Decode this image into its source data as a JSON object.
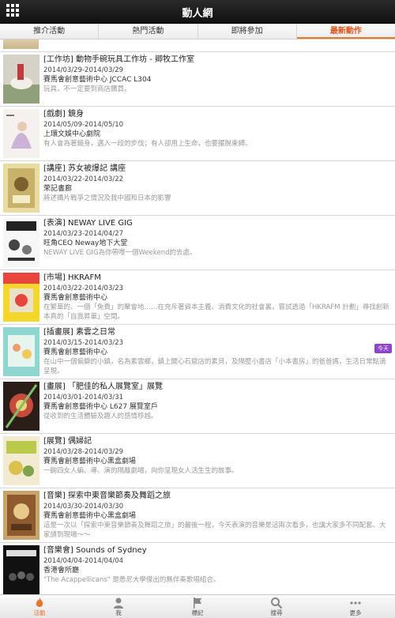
{
  "header": {
    "title": "動人網"
  },
  "tabs": [
    {
      "label": "推介活動"
    },
    {
      "label": "熱門活動"
    },
    {
      "label": "即將參加"
    },
    {
      "label": "最新動作"
    }
  ],
  "events": [
    {
      "title": "[工作坊] 動物手碗玩具工作坊 - 卿牧工作室",
      "date": "2014/03/29-2014/03/29",
      "venue": "賽馬會創意藝術中心 JCCAC L304",
      "desc": "玩具，不一定要到商店購買。",
      "badge": ""
    },
    {
      "title": "[戲劇] 鏡身",
      "date": "2014/05/09-2014/05/10",
      "venue": "上環文娛中心劇院",
      "desc": "有人會為著鏡身，邁入一段的步伐；有人卻用上生命，也要擺脫束縛。",
      "badge": ""
    },
    {
      "title": "[講座] 苏女被爆記 講座",
      "date": "2014/03/22-2014/03/22",
      "venue": "荣記書廊",
      "desc": "將述攝片戰爭之情況及我中國和日本的影響",
      "badge": ""
    },
    {
      "title": "[表演] NEWAY LIVE GIG",
      "date": "2014/03/23-2014/04/27",
      "venue": "旺角CEO Neway地下大堂",
      "desc": "NEWAY LIVE GIG為你帶嚟一個Weekend的去處。",
      "badge": ""
    },
    {
      "title": "[市場] HKRAFM",
      "date": "2014/03/22-2014/03/23",
      "venue": "賽馬會創意藝術中心",
      "desc": "在繁華的、一個「免費」的聚會地……在充斥著資本主義、消費文化的社會裏，嘗試透過「HKRAFM 計劃」尋找創新本真的「自我昇華」空間。",
      "badge": ""
    },
    {
      "title": "[插畫展] 素雲之日常",
      "date": "2014/03/15-2014/03/23",
      "venue": "賽馬會創意藝術中心",
      "desc": "在山中一個偏僻的小鎮，名為素雲鄉，鎮上開心石窟店的素貝，及隔壁小書店「小本書房」的爸爸媽，生活日常點滴呈現。",
      "badge": "今天"
    },
    {
      "title": "[畫展] 「肥佳的私人展覽室」展覽",
      "date": "2014/03/01-2014/03/31",
      "venue": "賽馬會創意藝術中心 L627 展覽室戶",
      "desc": "從收到的生活體驗及趣人的感情移越。",
      "badge": ""
    },
    {
      "title": "[展覽] 偶婦記",
      "date": "2014/03/28-2014/03/29",
      "venue": "賽馬會創意藝術中心黑盒劇場",
      "desc": "一齣四女人編、導、演的隔離劇場，向你呈現女人活生生的故事。",
      "badge": ""
    },
    {
      "title": "[音樂] 探索中東音樂節奏及舞蹈之旅",
      "date": "2014/03/30-2014/03/30",
      "venue": "賽馬會創意藝術中心黑盒劇場",
      "desc": "這是一次以「探索中東音樂節奏及舞蹈之旅」的最後一程，今天表演的音樂是這兩次看多，也讓大家多不同配套、大家請到現場～～",
      "badge": ""
    },
    {
      "title": "[音樂會] Sounds of Sydney",
      "date": "2014/04/04-2014/04/04",
      "venue": "香港會所廳",
      "desc": "\"The Acappellicans\" 是悉尼大學傑出的無伴奏歌唱組合。",
      "badge": ""
    }
  ],
  "bottom_nav": [
    {
      "label": "活動",
      "icon": "fire-icon"
    },
    {
      "label": "我",
      "icon": "person-icon"
    },
    {
      "label": "標記",
      "icon": "flag-icon"
    },
    {
      "label": "搜尋",
      "icon": "search-icon"
    },
    {
      "label": "更多",
      "icon": "more-icon"
    }
  ],
  "colors": {
    "accent": "#e8762c",
    "topbar": "#1a1a1a",
    "badge": "#8e44c9"
  }
}
